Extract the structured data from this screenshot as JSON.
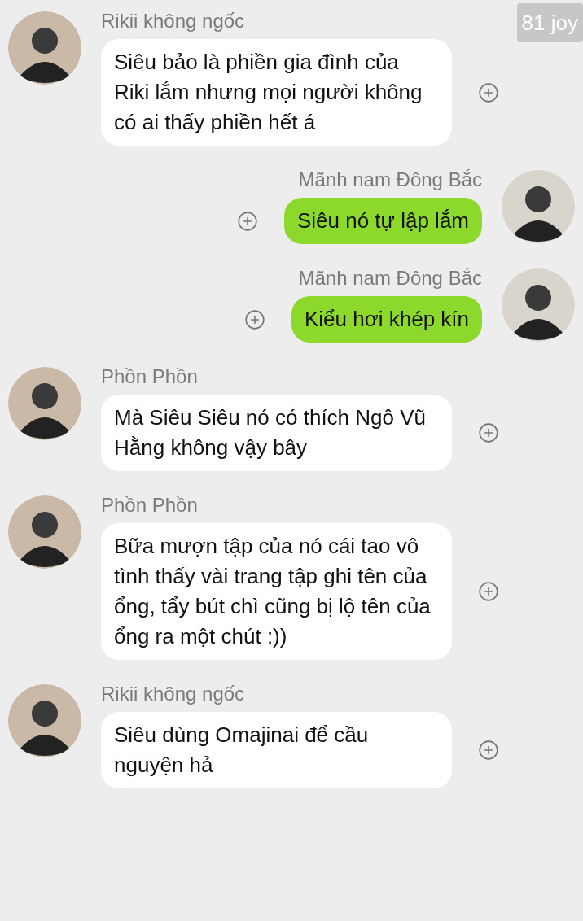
{
  "badge": "81 joy",
  "messages": [
    {
      "kind": "incoming",
      "sender": "Rikii không ngốc",
      "text": "Siêu bảo là phiền gia đình của Riki lắm nhưng mọi người không có ai thấy phiền hết á"
    },
    {
      "kind": "outgoing",
      "sender": "Mãnh nam Đông Bắc",
      "text": "Siêu nó tự lập lắm"
    },
    {
      "kind": "outgoing",
      "sender": "Mãnh nam Đông Bắc",
      "text": "Kiểu hơi khép kín"
    },
    {
      "kind": "incoming",
      "sender": "Phồn Phồn",
      "text": "Mà Siêu Siêu nó có thích Ngô Vũ Hằng không vậy bây"
    },
    {
      "kind": "incoming",
      "sender": "Phồn Phồn",
      "text": "Bữa mượn tập của nó cái tao vô tình thấy vài trang tập ghi tên của ổng, tẩy bút chì cũng bị lộ tên của ổng ra một chút :))"
    },
    {
      "kind": "incoming",
      "sender": "Rikii không ngốc",
      "text": "Siêu dùng Omajinai để cầu nguyện hả"
    }
  ]
}
